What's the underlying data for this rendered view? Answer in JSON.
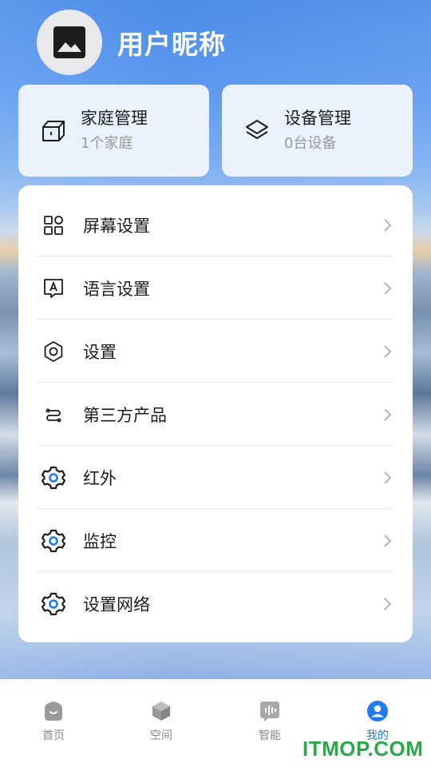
{
  "header": {
    "nickname": "用户昵称",
    "avatar_icon": "image-placeholder-icon"
  },
  "cards": [
    {
      "title": "家庭管理",
      "subtitle": "1个家庭",
      "icon": "home-box-icon"
    },
    {
      "title": "设备管理",
      "subtitle": "0台设备",
      "icon": "layers-icon"
    }
  ],
  "menu": [
    {
      "label": "屏幕设置",
      "icon": "grid-icon"
    },
    {
      "label": "语言设置",
      "icon": "language-icon"
    },
    {
      "label": "设置",
      "icon": "gear-icon"
    },
    {
      "label": "第三方产品",
      "icon": "link-icon"
    },
    {
      "label": "红外",
      "icon": "blue-gear-icon"
    },
    {
      "label": "监控",
      "icon": "blue-gear-icon"
    },
    {
      "label": "设置网络",
      "icon": "blue-gear-icon"
    }
  ],
  "tabs": [
    {
      "label": "首页",
      "icon": "home-icon",
      "active": false
    },
    {
      "label": "空间",
      "icon": "cube-icon",
      "active": false
    },
    {
      "label": "智能",
      "icon": "voice-icon",
      "active": false
    },
    {
      "label": "我的",
      "icon": "profile-icon",
      "active": true
    }
  ],
  "watermark": "ITMOP.COM",
  "colors": {
    "accent": "#1f7cf5",
    "card_bg": "#eaf2fe"
  }
}
